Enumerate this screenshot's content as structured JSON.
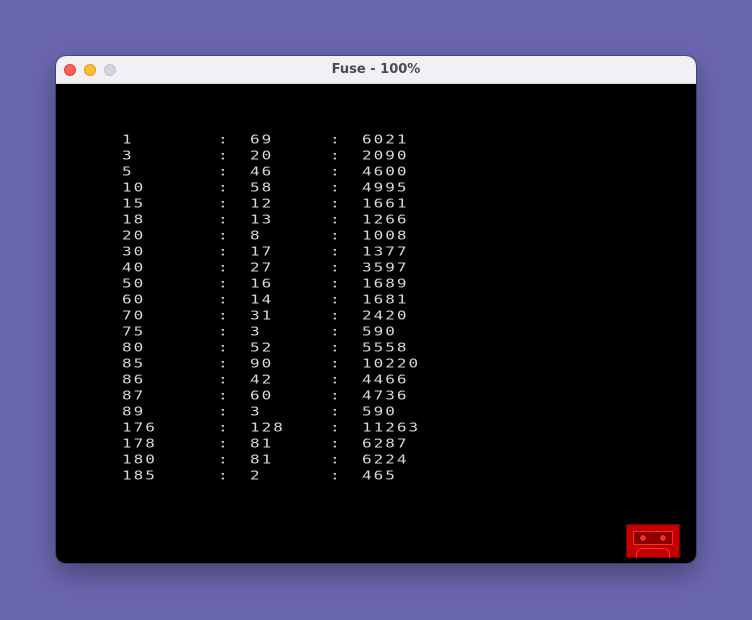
{
  "window": {
    "title": "Fuse - 100%"
  },
  "table": {
    "separator": ":",
    "rows": [
      {
        "a": "1",
        "b": "69",
        "c": "6021"
      },
      {
        "a": "3",
        "b": "20",
        "c": "2090"
      },
      {
        "a": "5",
        "b": "46",
        "c": "4600"
      },
      {
        "a": "10",
        "b": "58",
        "c": "4995"
      },
      {
        "a": "15",
        "b": "12",
        "c": "1661"
      },
      {
        "a": "18",
        "b": "13",
        "c": "1266"
      },
      {
        "a": "20",
        "b": "8",
        "c": "1008"
      },
      {
        "a": "30",
        "b": "17",
        "c": "1377"
      },
      {
        "a": "40",
        "b": "27",
        "c": "3597"
      },
      {
        "a": "50",
        "b": "16",
        "c": "1689"
      },
      {
        "a": "60",
        "b": "14",
        "c": "1681"
      },
      {
        "a": "70",
        "b": "31",
        "c": "2420"
      },
      {
        "a": "75",
        "b": "3",
        "c": "590"
      },
      {
        "a": "80",
        "b": "52",
        "c": "5558"
      },
      {
        "a": "85",
        "b": "90",
        "c": "10220"
      },
      {
        "a": "86",
        "b": "42",
        "c": "4466"
      },
      {
        "a": "87",
        "b": "60",
        "c": "4736"
      },
      {
        "a": "89",
        "b": "3",
        "c": "590"
      },
      {
        "a": "176",
        "b": "128",
        "c": "11263"
      },
      {
        "a": "178",
        "b": "81",
        "c": "6287"
      },
      {
        "a": "180",
        "b": "81",
        "c": "6224"
      },
      {
        "a": "185",
        "b": "2",
        "c": "465"
      }
    ]
  },
  "status": {
    "tape_icon": "cassette-tape-icon",
    "tape_color": "#c10000"
  }
}
